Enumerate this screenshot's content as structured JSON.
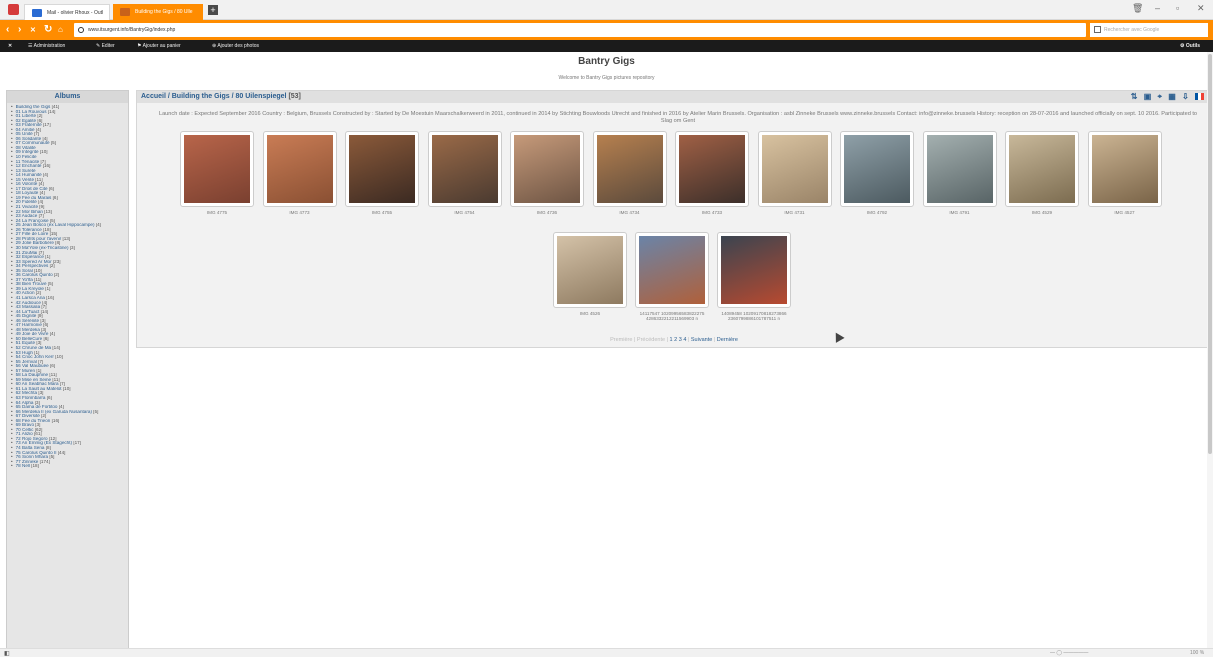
{
  "browser": {
    "tabs": [
      {
        "label": "Mail - olivier Rhoux - Outl"
      },
      {
        "label": "Building the Gigs / 80 Ulle"
      }
    ],
    "new_tab_label": "+",
    "url": "www.itsurgent.info/BantryGig/index.php",
    "search_placeholder": "Rechercher avec Google"
  },
  "adminbar": {
    "close": "✕",
    "administration": "Administration",
    "editer": "Editer",
    "ajouter_panier": "Ajouter au panier",
    "ajouter_photos": "Ajouter des photos",
    "outils": "Outils"
  },
  "site": {
    "title": "Bantry Gigs",
    "subtitle": "Welcome to Bantry Gigs pictures repository"
  },
  "sidebar": {
    "title": "Albums",
    "items": [
      {
        "label": "Building the Gigs",
        "count": "[41]"
      },
      {
        "label": "01 La Rouvous",
        "count": "[14]"
      },
      {
        "label": "01 Liberté",
        "count": "[2]"
      },
      {
        "label": "02 Egalité",
        "count": "[6]"
      },
      {
        "label": "03 Fraternité",
        "count": "[17]"
      },
      {
        "label": "04 Amitié",
        "count": "[4]"
      },
      {
        "label": "05 Unité",
        "count": "[7]"
      },
      {
        "label": "06 Solidarité",
        "count": "[4]"
      },
      {
        "label": "07 Communauté",
        "count": "[5]"
      },
      {
        "label": "08 Vitalité",
        "count": ""
      },
      {
        "label": "09 Intégrité",
        "count": "[10]"
      },
      {
        "label": "10 Felicite",
        "count": ""
      },
      {
        "label": "11 Ténacité",
        "count": "[7]"
      },
      {
        "label": "12 Enchanté",
        "count": "[16]"
      },
      {
        "label": "13 Sureté",
        "count": ""
      },
      {
        "label": "14 Humanité",
        "count": "[4]"
      },
      {
        "label": "15 Vérité",
        "count": "[11]"
      },
      {
        "label": "16 Volonté",
        "count": "[4]"
      },
      {
        "label": "17 Droit de Cité",
        "count": "[6]"
      },
      {
        "label": "18 Loyauté",
        "count": "[4]"
      },
      {
        "label": "19 Fée du Marais",
        "count": "[6]"
      },
      {
        "label": "20 Fidelité",
        "count": "[4]"
      },
      {
        "label": "21 Vivacité",
        "count": "[9]"
      },
      {
        "label": "22 Mor Bihan",
        "count": "[13]"
      },
      {
        "label": "23 Audace",
        "count": "[7]"
      },
      {
        "label": "24 La Françoise",
        "count": "[5]"
      },
      {
        "label": "25 Jean Bosco (ex Laval Hippocampe)",
        "count": "[4]"
      },
      {
        "label": "26 Tolérance",
        "count": "[18]"
      },
      {
        "label": "27 Fille de Loire",
        "count": "[15]"
      },
      {
        "label": "28 Profits pour l'avenir",
        "count": "[13]"
      },
      {
        "label": "29 Jolie Barbotière",
        "count": "[8]"
      },
      {
        "label": "30 Ma'Yole (ex-Tricastine)",
        "count": "[3]"
      },
      {
        "label": "31 ZouMai",
        "count": "[7]"
      },
      {
        "label": "32 Espérance",
        "count": "[1]"
      },
      {
        "label": "33 Spered Ar Mor",
        "count": "[23]"
      },
      {
        "label": "34 Perspectives",
        "count": "[2]"
      },
      {
        "label": "35 Soral",
        "count": "[10]"
      },
      {
        "label": "36 Carolus Quinto",
        "count": "[2]"
      },
      {
        "label": "37 Yo'lfa",
        "count": "[11]"
      },
      {
        "label": "38 Bien Trouvé",
        "count": "[5]"
      },
      {
        "label": "39 La Kreyole",
        "count": "[1]"
      },
      {
        "label": "40 Action",
        "count": "[2]"
      },
      {
        "label": "41 Larsca Ana",
        "count": "[16]"
      },
      {
        "label": "42 Audiouce",
        "count": "[4]"
      },
      {
        "label": "43 Massalia",
        "count": "[7]"
      },
      {
        "label": "44 La'Tuact",
        "count": "[14]"
      },
      {
        "label": "45 Dignité",
        "count": "[9]"
      },
      {
        "label": "46 Sérénité",
        "count": "[3]"
      },
      {
        "label": "47 Harmonie",
        "count": "[6]"
      },
      {
        "label": "48 Merdeka",
        "count": "[3]"
      },
      {
        "label": "49 Joie de Vivre",
        "count": "[4]"
      },
      {
        "label": "50 BelleCure",
        "count": "[6]"
      },
      {
        "label": "51 Equité",
        "count": "[3]"
      },
      {
        "label": "52 Chrune de Ma",
        "count": "[14]"
      },
      {
        "label": "53 Hugh",
        "count": "[1]"
      },
      {
        "label": "54 Cnoc John Kerr",
        "count": "[10]"
      },
      {
        "label": "55 Jernval",
        "count": "[7]"
      },
      {
        "label": "56 Val Maubuée",
        "count": "[6]"
      },
      {
        "label": "57 Muren",
        "count": "[1]"
      },
      {
        "label": "58 La Dauphine",
        "count": "[11]"
      },
      {
        "label": "59 Mise en Seine",
        "count": "[11]"
      },
      {
        "label": "60 An Seabhac Mara",
        "count": "[7]"
      },
      {
        "label": "61 La Sault au Matelot",
        "count": "[10]"
      },
      {
        "label": "62 Mechta",
        "count": "[3]"
      },
      {
        "label": "63 Florimbarra",
        "count": "[6]"
      },
      {
        "label": "64 Alpha",
        "count": "[3]"
      },
      {
        "label": "65 Dama de Fortitoo",
        "count": "[4]"
      },
      {
        "label": "66 Merdeka II (ex Garuda Nusantara)",
        "count": "[5]"
      },
      {
        "label": "67 Diversité",
        "count": "[2]"
      },
      {
        "label": "68 Fée du Trieon",
        "count": "[16]"
      },
      {
        "label": "69 Bravo",
        "count": "[3]"
      },
      {
        "label": "70 Celtic",
        "count": "[62]"
      },
      {
        "label": "71 Alizio",
        "count": "[61]"
      },
      {
        "label": "72 Rojo Segoro",
        "count": "[12]"
      },
      {
        "label": "73 An Emmig (Ex Stagecht)",
        "count": "[17]"
      },
      {
        "label": "74 Balta Sena",
        "count": "[8]"
      },
      {
        "label": "75 Carolus Quinto II",
        "count": "[44]"
      },
      {
        "label": "76 Sionn Mhara",
        "count": "[5]"
      },
      {
        "label": "77 Zinneke",
        "count": "[174]"
      },
      {
        "label": "78 Nell",
        "count": "[18]"
      }
    ]
  },
  "main": {
    "breadcrumb": "Accueil / Building the Gigs / 80 Uilenspiegel",
    "count": "[53]",
    "description": "Launch date : Expected September 2016 Country : Belgium, Brussels Constructed by : Started by De Moestuin Maarschalkerweerd in 2011, continued in 2014 by Stichting Bouwloods Utrecht and finished in 2016 by Atelier Marin Brussels. Organisation : asbl Zinneke Brussels www.zinneke.brussels Contact: info@zinneke.brussels History: reception on 28-07-2016 and launched officially on sept. 10 2016. Participated to Slag om Gent",
    "photos": [
      {
        "caption": "IMG 4775"
      },
      {
        "caption": "IMG 4773"
      },
      {
        "caption": "IMG 4755"
      },
      {
        "caption": "IMG 4754"
      },
      {
        "caption": "IMG 4736"
      },
      {
        "caption": "IMG 4734"
      },
      {
        "caption": "IMG 4733"
      },
      {
        "caption": "IMG 4731"
      },
      {
        "caption": "IMG 4792"
      },
      {
        "caption": "IMG 4791"
      },
      {
        "caption": "IMG 4529"
      },
      {
        "caption": "IMG 4527"
      },
      {
        "caption": "IMG 4526"
      },
      {
        "caption": "14117547 10209956583822275 4286332212211569903 n"
      },
      {
        "caption": "14089458 10209170818273866 2360799886101787511 n"
      }
    ],
    "pager": {
      "premiere": "Première",
      "precedente": "Précédente",
      "sep": "|",
      "pages": [
        "1",
        "2",
        "3",
        "4"
      ],
      "suivante": "Suivante",
      "derniere": "Dernière"
    }
  },
  "status": {
    "zoom": "100 %"
  }
}
